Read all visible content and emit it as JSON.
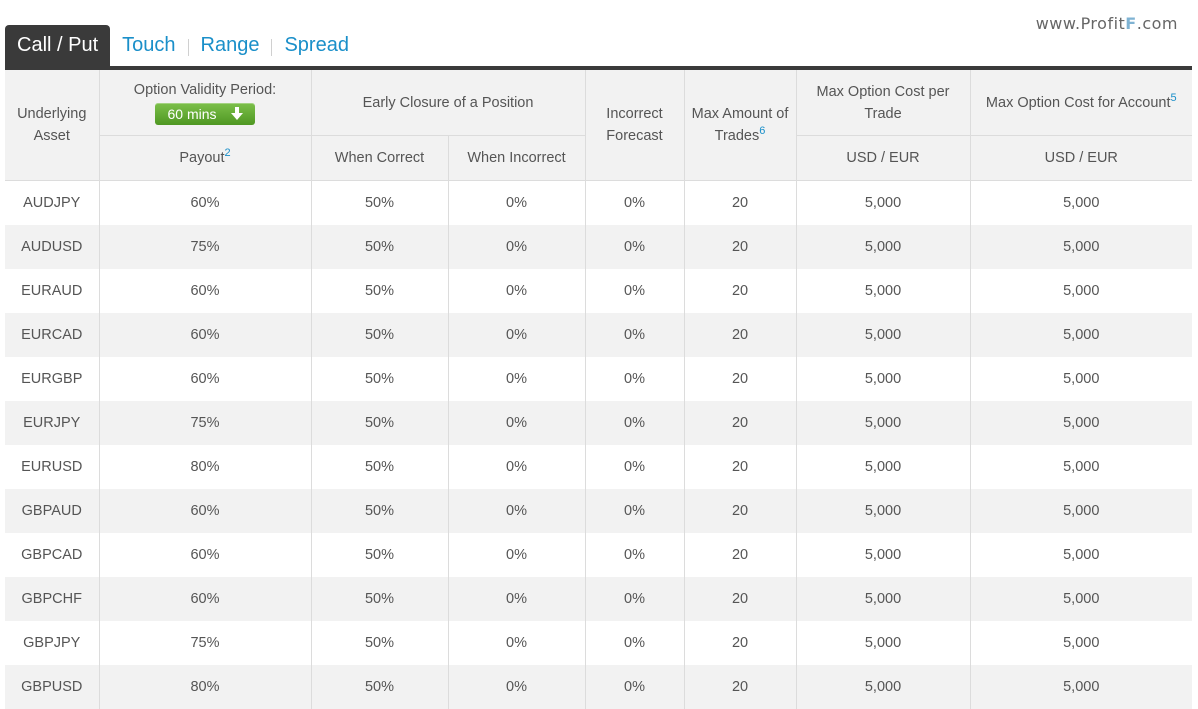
{
  "watermark": {
    "prefix": "www.Profit",
    "f": "F",
    "suffix": ".com"
  },
  "tabs": [
    {
      "label": "Call / Put",
      "active": true
    },
    {
      "label": "Touch",
      "active": false
    },
    {
      "label": "Range",
      "active": false
    },
    {
      "label": "Spread",
      "active": false
    }
  ],
  "header": {
    "underlying_asset": "Underlying Asset",
    "validity_period": "Option Validity Period:",
    "period_button": "60 mins",
    "period_icon": "arrow-down-icon",
    "early_closure": "Early Closure of a Position",
    "incorrect_forecast": "Incorrect Forecast",
    "max_amount": "Max Amount of Trades",
    "max_amount_sup": "6",
    "max_cost_trade": "Max Option Cost per Trade",
    "max_cost_account": "Max Option Cost for Account",
    "max_cost_account_sup": "5",
    "payout": "Payout",
    "payout_sup": "2",
    "when_correct": "When Correct",
    "when_incorrect": "When Incorrect",
    "currency_trade": "USD / EUR",
    "currency_account": "USD / EUR"
  },
  "rows": [
    [
      "AUDJPY",
      "60%",
      "50%",
      "0%",
      "0%",
      "20",
      "5,000",
      "5,000"
    ],
    [
      "AUDUSD",
      "75%",
      "50%",
      "0%",
      "0%",
      "20",
      "5,000",
      "5,000"
    ],
    [
      "EURAUD",
      "60%",
      "50%",
      "0%",
      "0%",
      "20",
      "5,000",
      "5,000"
    ],
    [
      "EURCAD",
      "60%",
      "50%",
      "0%",
      "0%",
      "20",
      "5,000",
      "5,000"
    ],
    [
      "EURGBP",
      "60%",
      "50%",
      "0%",
      "0%",
      "20",
      "5,000",
      "5,000"
    ],
    [
      "EURJPY",
      "75%",
      "50%",
      "0%",
      "0%",
      "20",
      "5,000",
      "5,000"
    ],
    [
      "EURUSD",
      "80%",
      "50%",
      "0%",
      "0%",
      "20",
      "5,000",
      "5,000"
    ],
    [
      "GBPAUD",
      "60%",
      "50%",
      "0%",
      "0%",
      "20",
      "5,000",
      "5,000"
    ],
    [
      "GBPCAD",
      "60%",
      "50%",
      "0%",
      "0%",
      "20",
      "5,000",
      "5,000"
    ],
    [
      "GBPCHF",
      "60%",
      "50%",
      "0%",
      "0%",
      "20",
      "5,000",
      "5,000"
    ],
    [
      "GBPJPY",
      "75%",
      "50%",
      "0%",
      "0%",
      "20",
      "5,000",
      "5,000"
    ],
    [
      "GBPUSD",
      "80%",
      "50%",
      "0%",
      "0%",
      "20",
      "5,000",
      "5,000"
    ]
  ],
  "colors": {
    "accent": "#1a8fc9",
    "tab_active": "#3a3a3a",
    "button_green": "#5ea82f"
  }
}
